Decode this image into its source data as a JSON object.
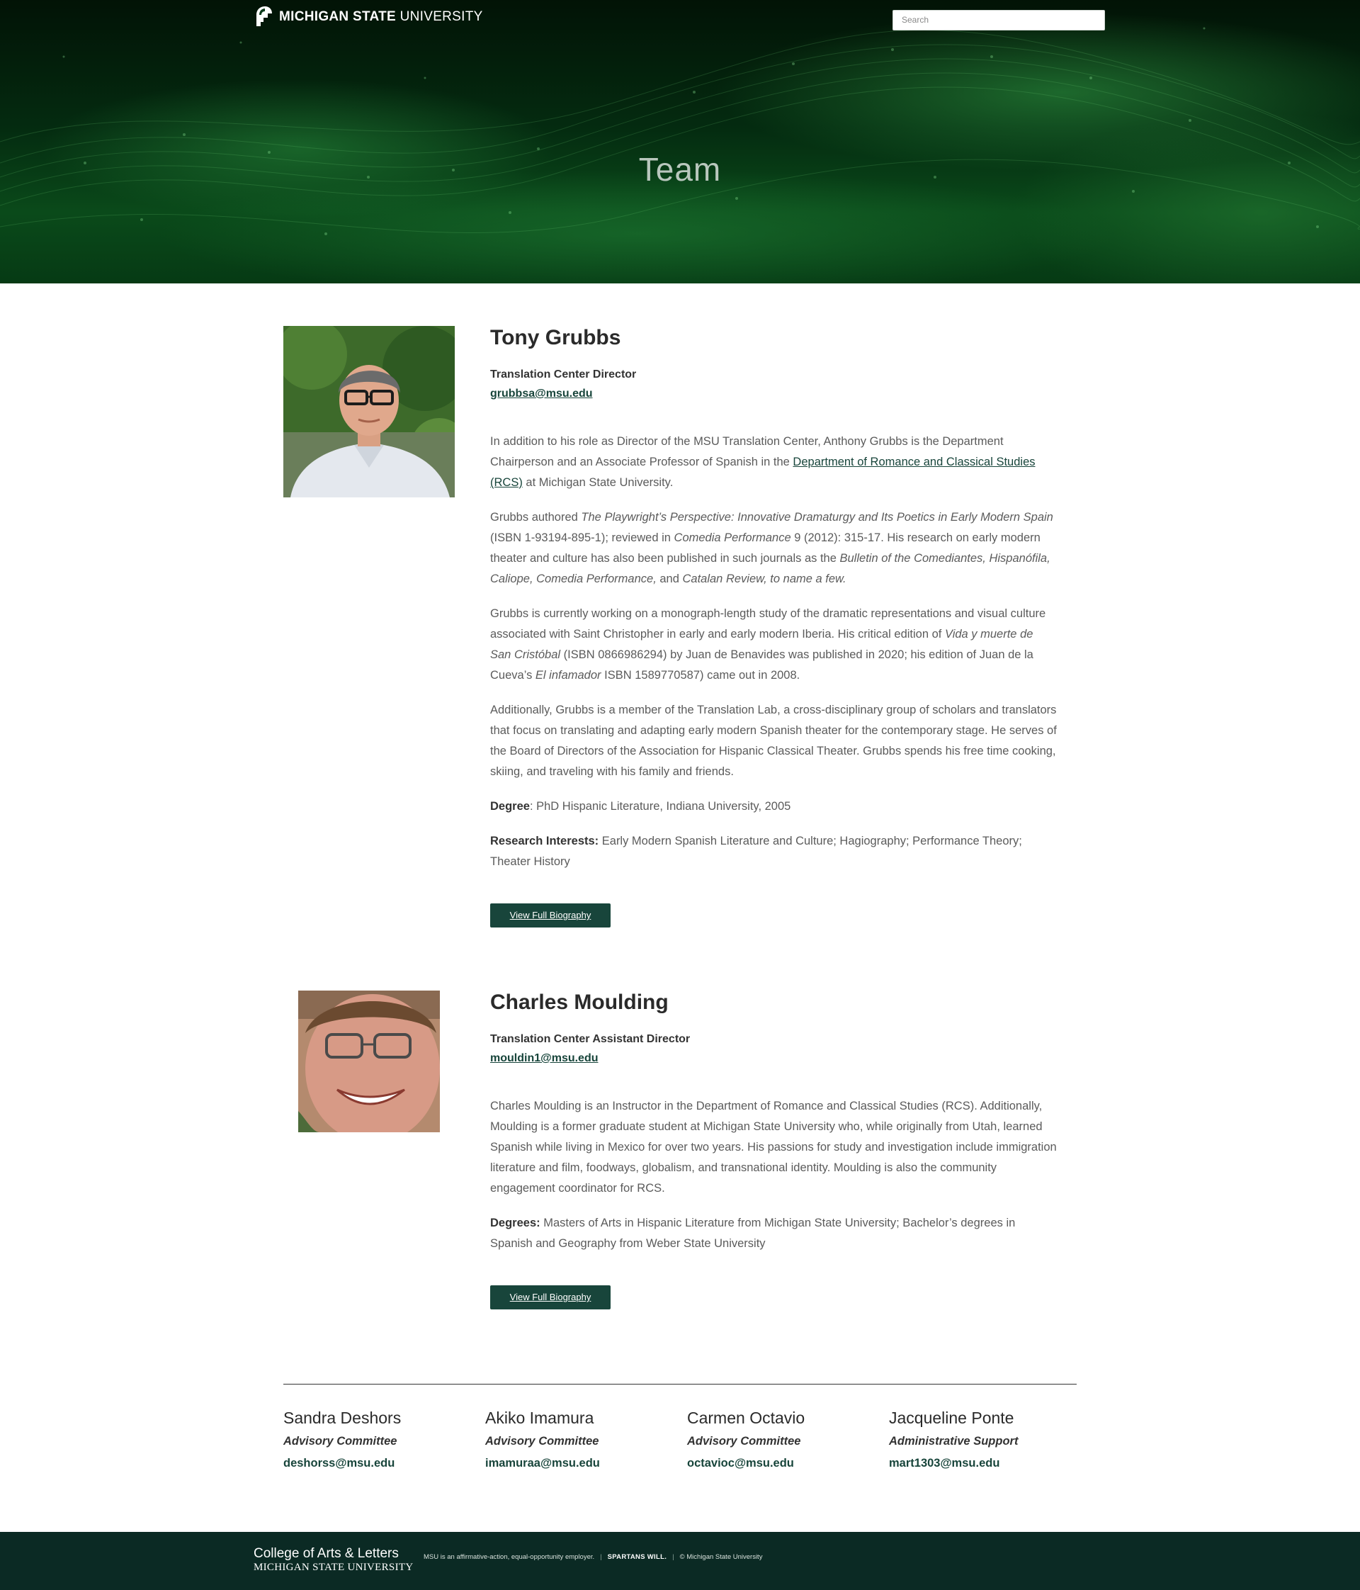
{
  "header": {
    "logo_bold": "MICHIGAN STATE",
    "logo_light": "UNIVERSITY",
    "search_placeholder": "Search",
    "page_title": "Team"
  },
  "profiles": [
    {
      "name": "Tony Grubbs",
      "role": "Translation Center Director",
      "email": "grubbsa@msu.edu",
      "bio": {
        "p1_before": "In addition to his role as Director of the MSU Translation Center, Anthony Grubbs is the Department Chairperson and an Associate Professor of Spanish in the ",
        "p1_link": "Department of Romance and Classical Studies (RCS)",
        "p1_after": " at Michigan State University.",
        "p2_a": "Grubbs authored ",
        "p2_b": "The Playwright’s Perspective: Innovative Dramaturgy and Its Poetics in Early Modern Spain",
        "p2_c": " (ISBN 1-93194-895-1); reviewed in ",
        "p2_d": "Comedia Performance",
        "p2_e": " 9 (2012): 315-17. His research on early modern theater and culture has also been published in such journals as the ",
        "p2_f": "Bulletin of the Comediantes, Hispanófila, Caliope, Comedia Performance,",
        "p2_g": " and ",
        "p2_h": "Catalan Review, to name a few.",
        "p3_a": "Grubbs is currently working on a monograph-length study of the dramatic representations and visual culture associated with Saint Christopher in early and early modern Iberia. His critical edition of ",
        "p3_b": "Vida y muerte de San Cristóbal",
        "p3_c": " (ISBN 0866986294) by Juan de Benavides was published in 2020; his edition of Juan de la Cueva’s ",
        "p3_d": "El infamador",
        "p3_e": " ISBN 1589770587) came out in 2008.",
        "p4": "Additionally, Grubbs is a member of the Translation Lab, a cross-disciplinary group of scholars and translators that focus on translating and adapting early modern Spanish theater for the contemporary stage. He serves of the Board of Directors of the Association for Hispanic Classical Theater. Grubbs spends his free time cooking, skiing, and traveling with his family and friends.",
        "degree_label": "Degree",
        "degree_value": ": PhD Hispanic Literature, Indiana University, 2005",
        "interests_label": "Research Interests:",
        "interests_value": " Early Modern Spanish Literature and Culture; Hagiography; Performance Theory; Theater History"
      },
      "button": "View Full Biography"
    },
    {
      "name": "Charles Moulding",
      "role": "Translation Center Assistant Director",
      "email": "mouldin1@msu.edu",
      "bio": {
        "p1": "Charles Moulding is an Instructor in the Department of Romance and Classical Studies (RCS). Additionally, Moulding is a former graduate student at Michigan State University who, while originally from Utah, learned Spanish while living in Mexico for over two years. His passions for study and investigation include immigration literature and film, foodways, globalism, and transnational identity. Moulding is also the community engagement coordinator for RCS.",
        "degrees_label": "Degrees:",
        "degrees_value": " Masters of Arts in Hispanic Literature from Michigan State University; Bachelor’s degrees in Spanish and Geography from Weber State University"
      },
      "button": "View Full Biography"
    }
  ],
  "staff": [
    {
      "name": "Sandra Deshors",
      "role": "Advisory Committee",
      "email": "deshorss@msu.edu"
    },
    {
      "name": "Akiko Imamura",
      "role": "Advisory Committee",
      "email": "imamuraa@msu.edu"
    },
    {
      "name": "Carmen Octavio",
      "role": "Advisory Committee",
      "email": "octavioc@msu.edu"
    },
    {
      "name": "Jacqueline Ponte",
      "role": "Administrative Support",
      "email": "mart1303@msu.edu"
    }
  ],
  "footer": {
    "college": "College of Arts & Letters",
    "university": "MICHIGAN STATE UNIVERSITY",
    "legal": "MSU is an affirmative-action, equal-opportunity employer.",
    "tagline": "SPARTANS WILL.",
    "copyright": "© Michigan State University"
  },
  "colors": {
    "msu_green": "#18453b",
    "footer_bg": "#0b2a24",
    "hero_green": "#0a4a1a"
  },
  "icons": {
    "logo": "spartan-helmet-icon"
  }
}
